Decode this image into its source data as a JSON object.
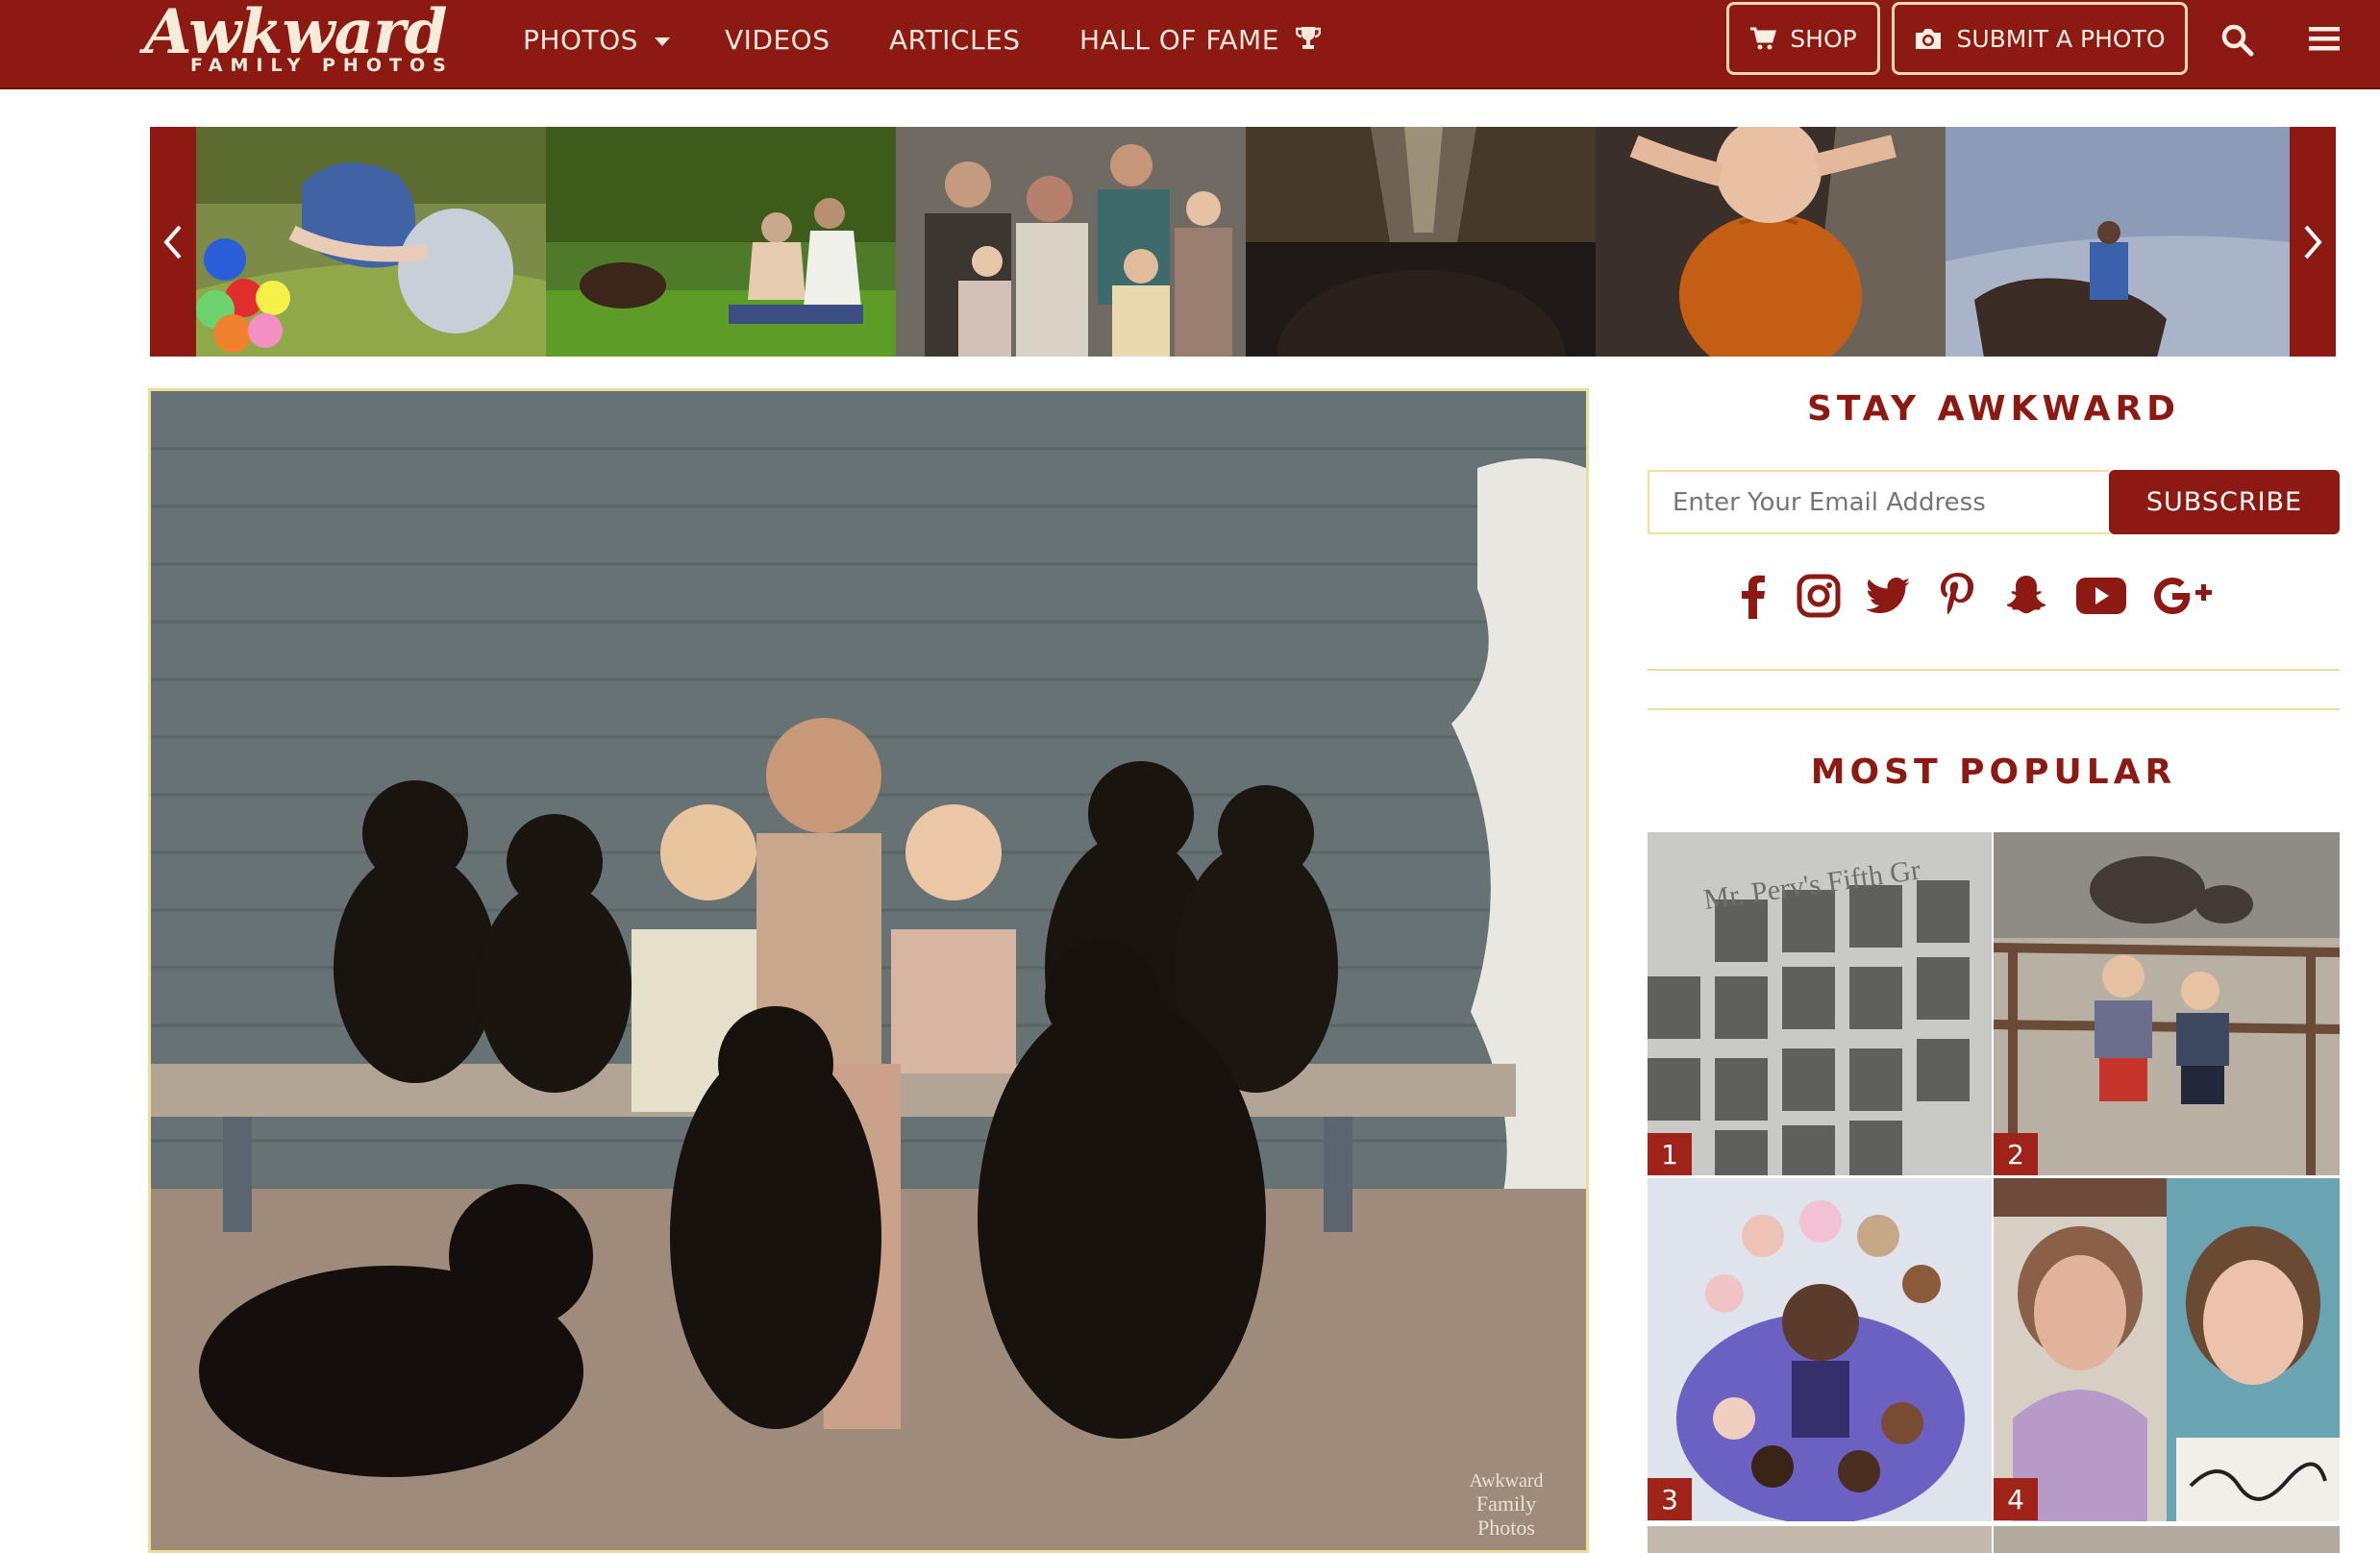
{
  "header": {
    "logo_text": "Awkward",
    "logo_subtext": "FAMILY PHOTOS",
    "nav": {
      "photos": "PHOTOS",
      "videos": "VIDEOS",
      "articles": "ARTICLES",
      "hall_of_fame": "HALL OF FAME"
    },
    "shop_label": "SHOP",
    "submit_label": "SUBMIT A PHOTO"
  },
  "carousel": {
    "photos": [
      "balloons-girl-photo",
      "lakeside-couple-photo",
      "family-portrait-photo",
      "closeup-portrait-photo",
      "pumpkin-baby-photo",
      "horse-rider-photo"
    ]
  },
  "main_photo": {
    "watermark": [
      "Awkward",
      "Family",
      "Photos"
    ]
  },
  "sidebar": {
    "stay_title": "STAY AWKWARD",
    "email_placeholder": "Enter Your Email Address",
    "subscribe_label": "SUBSCRIBE",
    "social": [
      "facebook-icon",
      "instagram-icon",
      "twitter-icon",
      "pinterest-icon",
      "snapchat-icon",
      "youtube-icon",
      "google-plus-icon"
    ],
    "popular_title": "MOST POPULAR",
    "popular": [
      {
        "rank": "1",
        "caption_text": "Mr. Perv's Fifth Gr"
      },
      {
        "rank": "2"
      },
      {
        "rank": "3"
      },
      {
        "rank": "4"
      }
    ]
  },
  "colors": {
    "brand": "#8c1a12",
    "accent": "#ecdd97",
    "header_text": "#f3e8dd"
  }
}
